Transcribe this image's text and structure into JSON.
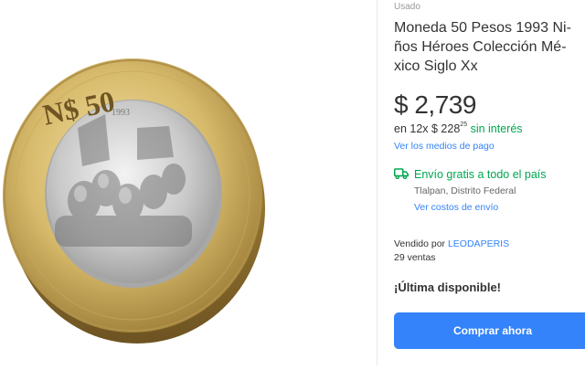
{
  "product": {
    "condition": "Usado",
    "title": "Moneda 50 Pesos 1993 Ni-\nños Héroes Colección Mé-\nxico Siglo Xx",
    "image": {
      "coin_top_text": "N$ 50",
      "coin_year": "1993"
    }
  },
  "pricing": {
    "price": "$ 2,739",
    "installments_prefix": "en 12x $ 228",
    "installments_cents": "25",
    "installments_suffix": " sin interés",
    "payment_link": "Ver los medios de pago"
  },
  "shipping": {
    "title": "Envío gratis a todo el país",
    "location": "Tlalpan, Distrito Federal",
    "cost_link": "Ver costos de envío"
  },
  "seller": {
    "label": "Vendido por ",
    "name": "LEODAPERIS",
    "sales": "29 ventas"
  },
  "stock": {
    "message": "¡Última disponible!"
  },
  "actions": {
    "buy_label": "Comprar ahora"
  },
  "colors": {
    "accent": "#3483fa",
    "success": "#00a650",
    "coin_ring": "#d7ba6b",
    "coin_center": "#c9c9c9"
  },
  "icons": {
    "shipping": "truck-icon"
  }
}
